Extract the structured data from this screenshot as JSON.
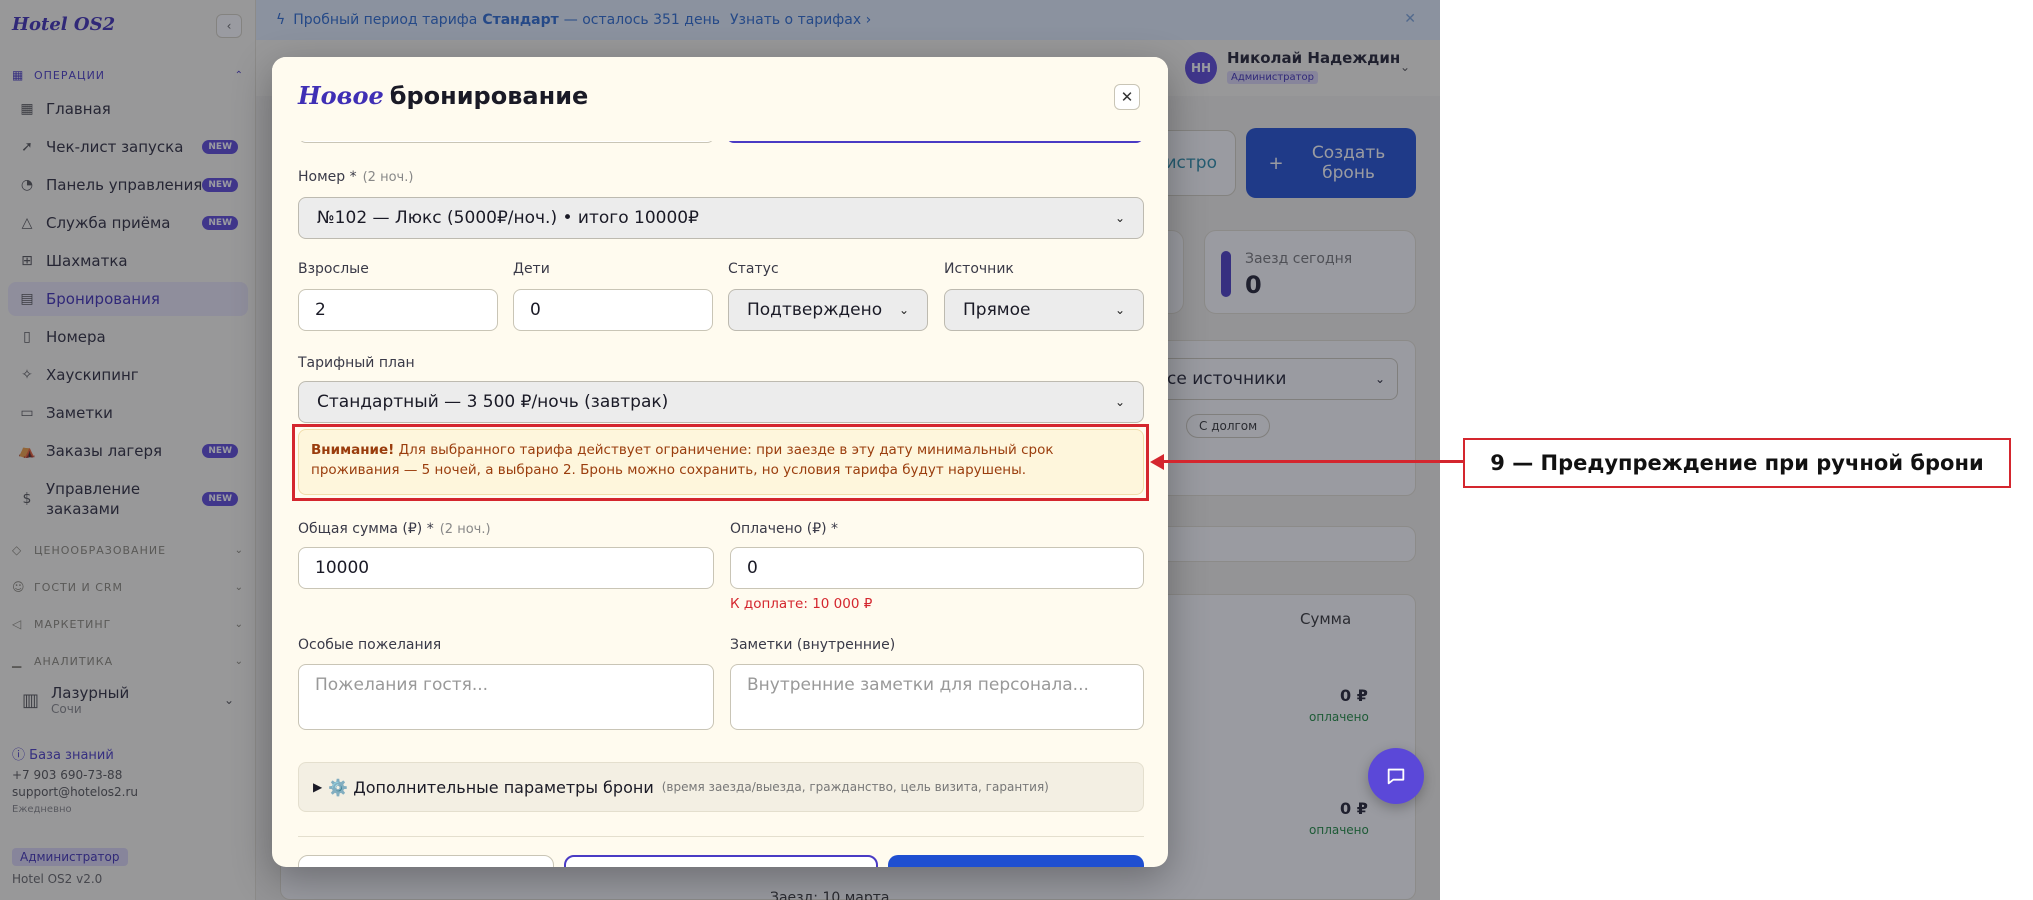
{
  "app": {
    "logo": "Hotel OS2",
    "sidebar": {
      "section_operations": "ОПЕРАЦИИ",
      "items": [
        {
          "label": "Главная",
          "badge": ""
        },
        {
          "label": "Чек-лист запуска",
          "badge": "NEW"
        },
        {
          "label": "Панель управления",
          "badge": "NEW"
        },
        {
          "label": "Служба приёма",
          "badge": "NEW"
        },
        {
          "label": "Шахматка",
          "badge": ""
        },
        {
          "label": "Бронирования",
          "badge": ""
        },
        {
          "label": "Номера",
          "badge": ""
        },
        {
          "label": "Хаускипинг",
          "badge": ""
        },
        {
          "label": "Заметки",
          "badge": ""
        },
        {
          "label": "Заказы лагеря",
          "badge": "NEW"
        },
        {
          "label": "Управление заказами",
          "badge": "NEW"
        }
      ],
      "sections_collapsed": [
        "ЦЕНООБРАЗОВАНИЕ",
        "ГОСТИ И CRM",
        "МАРКЕТИНГ",
        "АНАЛИТИКА"
      ],
      "hotel_name": "Лазурный",
      "hotel_city": "Сочи",
      "knowledge_base": "База знаний",
      "phone": "+7 903 690-73-88",
      "email": "support@hotelos2.ru",
      "schedule": "Ежедневно",
      "role": "Администратор",
      "version": "Hotel OS2 v2.0"
    },
    "trial_bar": {
      "prefix": "Пробный период тарифа",
      "plan": "Стандарт",
      "remaining": "— осталось 351 день",
      "link": "Узнать о тарифах ›"
    },
    "user": {
      "initials": "НН",
      "name": "Николай Надеждин",
      "role": "Администратор"
    },
    "create_button": "Создать бронь",
    "register_button": "истро",
    "stat_arrival_label": "Заезд сегодня",
    "stat_arrival_value": "0",
    "filter_source": "се источники",
    "chip_debt": "С долгом",
    "table_sum_header": "Сумма",
    "rows": [
      {
        "amount": "0 ₽",
        "status": "оплачено"
      },
      {
        "amount": "0 ₽",
        "status": "оплачено"
      }
    ],
    "arrival_date_text": "Заезд: 10 марта"
  },
  "modal": {
    "title_accent": "Новое",
    "title_main": "бронирование",
    "room": {
      "label": "Номер *",
      "hint": "(2 ноч.)",
      "value": "№102 — Люкс (5000₽/ноч.) • итого 10000₽"
    },
    "adults": {
      "label": "Взрослые",
      "value": "2"
    },
    "children": {
      "label": "Дети",
      "value": "0"
    },
    "status": {
      "label": "Статус",
      "value": "Подтверждено"
    },
    "source": {
      "label": "Источник",
      "value": "Прямое"
    },
    "tariff": {
      "label": "Тарифный план",
      "value": "Стандартный — 3 500 ₽/ночь (завтрак)"
    },
    "warning": {
      "title": "Внимание!",
      "text": "Для выбранного тарифа действует ограничение: при заезде в эту дату минимальный срок проживания — 5 ночей, а выбрано 2. Бронь можно сохранить, но условия тарифа будут нарушены."
    },
    "total": {
      "label": "Общая сумма (₽) *",
      "hint": "(2 ноч.)",
      "value": "10000"
    },
    "paid": {
      "label": "Оплачено (₽) *",
      "value": "0"
    },
    "due": "К доплате: 10 000 ₽",
    "wishes": {
      "label": "Особые пожелания",
      "placeholder": "Пожелания гостя..."
    },
    "notes": {
      "label": "Заметки (внутренние)",
      "placeholder": "Внутренние заметки для персонала..."
    },
    "extra": {
      "label": "⚙️ Дополнительные параметры брони",
      "sub": "(время заезда/выезда, гражданство, цель визита, гарантия)"
    }
  },
  "annotation": {
    "label": "9 — Предупреждение при ручной брони"
  },
  "colors": {
    "accent": "#3f2fb5",
    "primary": "#1f4fd1",
    "warning_text": "#9a3d0d",
    "annotation": "#d4262e"
  }
}
